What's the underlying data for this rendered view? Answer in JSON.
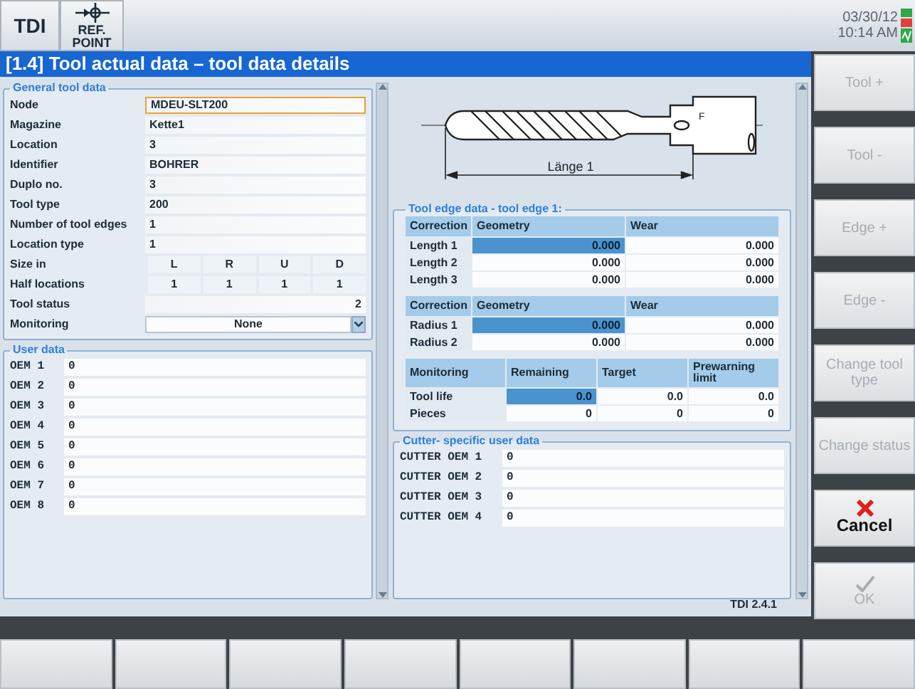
{
  "header": {
    "buttons": [
      {
        "label": "TDI",
        "kind": "text"
      },
      {
        "label": "REF. POINT",
        "kind": "refpoint"
      }
    ],
    "date": "03/30/12",
    "time": "10:14 AM"
  },
  "title": "[1.4] Tool actual data – tool data details",
  "general_tool_data": {
    "legend": "General tool data",
    "rows": [
      {
        "kind": "field",
        "label": "Node",
        "value": "MDEU-SLT200",
        "focused": true
      },
      {
        "kind": "field",
        "label": "Magazine",
        "value": "Kette1",
        "focused": false
      },
      {
        "kind": "field",
        "label": "Location",
        "value": "3",
        "focused": false
      },
      {
        "kind": "field",
        "label": "Identifier",
        "value": "BOHRER",
        "focused": false
      },
      {
        "kind": "field",
        "label": "Duplo no.",
        "value": "3",
        "focused": false
      },
      {
        "kind": "field",
        "label": "Tool type",
        "value": "200",
        "focused": false
      },
      {
        "kind": "field",
        "label": "Number of tool edges",
        "value": "1",
        "focused": false
      },
      {
        "kind": "field",
        "label": "Location type",
        "value": "1",
        "focused": false
      },
      {
        "kind": "grid",
        "label": "Size in",
        "values": [
          "L",
          "R",
          "U",
          "D"
        ]
      },
      {
        "kind": "grid",
        "label": "Half locations",
        "values": [
          "1",
          "1",
          "1",
          "1"
        ]
      },
      {
        "kind": "status",
        "label": "Tool status",
        "value": "2"
      },
      {
        "kind": "dropdown",
        "label": "Monitoring",
        "value": "None"
      }
    ]
  },
  "user_data": {
    "legend": "User data",
    "rows": [
      {
        "label": "OEM 1",
        "value": "0"
      },
      {
        "label": "OEM 2",
        "value": "0"
      },
      {
        "label": "OEM 3",
        "value": "0"
      },
      {
        "label": "OEM 4",
        "value": "0"
      },
      {
        "label": "OEM 5",
        "value": "0"
      },
      {
        "label": "OEM 6",
        "value": "0"
      },
      {
        "label": "OEM 7",
        "value": "0"
      },
      {
        "label": "OEM 8",
        "value": "0"
      }
    ]
  },
  "drawing": {
    "dimension_label": "Länge 1",
    "point_label": "F"
  },
  "tool_edge_data": {
    "legend": "Tool edge data - tool edge 1:",
    "tables": [
      {
        "columns": [
          "Correction",
          "Geometry",
          "Wear"
        ],
        "rows": [
          {
            "label": "Length 1",
            "cells": [
              "0.000",
              "0.000"
            ],
            "selected": true
          },
          {
            "label": "Length 2",
            "cells": [
              "0.000",
              "0.000"
            ],
            "selected": false
          },
          {
            "label": "Length 3",
            "cells": [
              "0.000",
              "0.000"
            ],
            "selected": false
          }
        ]
      },
      {
        "columns": [
          "Correction",
          "Geometry",
          "Wear"
        ],
        "rows": [
          {
            "label": "Radius 1",
            "cells": [
              "0.000",
              "0.000"
            ],
            "selected": true
          },
          {
            "label": "Radius 2",
            "cells": [
              "0.000",
              "0.000"
            ],
            "selected": false
          }
        ]
      },
      {
        "columns": [
          "Monitoring",
          "Remaining",
          "Target",
          "Prewarning limit"
        ],
        "rows": [
          {
            "label": "Tool life",
            "cells": [
              "0.0",
              "0.0",
              "0.0"
            ],
            "selected": true
          },
          {
            "label": "Pieces",
            "cells": [
              "0",
              "0",
              "0"
            ],
            "selected": false
          }
        ]
      }
    ]
  },
  "cutter_user_data": {
    "legend": "Cutter- specific user data",
    "rows": [
      {
        "label": "CUTTER OEM 1",
        "value": "0"
      },
      {
        "label": "CUTTER OEM 2",
        "value": "0"
      },
      {
        "label": "CUTTER OEM 3",
        "value": "0"
      },
      {
        "label": "CUTTER OEM 4",
        "value": "0"
      }
    ]
  },
  "version": "TDI 2.4.1",
  "softkeys": [
    {
      "label": "Tool +",
      "kind": "text",
      "disabled": true
    },
    {
      "label": "Tool -",
      "kind": "text",
      "disabled": true
    },
    {
      "label": "Edge +",
      "kind": "text",
      "disabled": true
    },
    {
      "label": "Edge -",
      "kind": "text",
      "disabled": true
    },
    {
      "label": "Change tool type",
      "kind": "text",
      "disabled": true
    },
    {
      "label": "Change status",
      "kind": "text",
      "disabled": true
    },
    {
      "label": "Cancel",
      "kind": "cancel",
      "disabled": false
    },
    {
      "label": "OK",
      "kind": "ok",
      "disabled": true
    }
  ]
}
